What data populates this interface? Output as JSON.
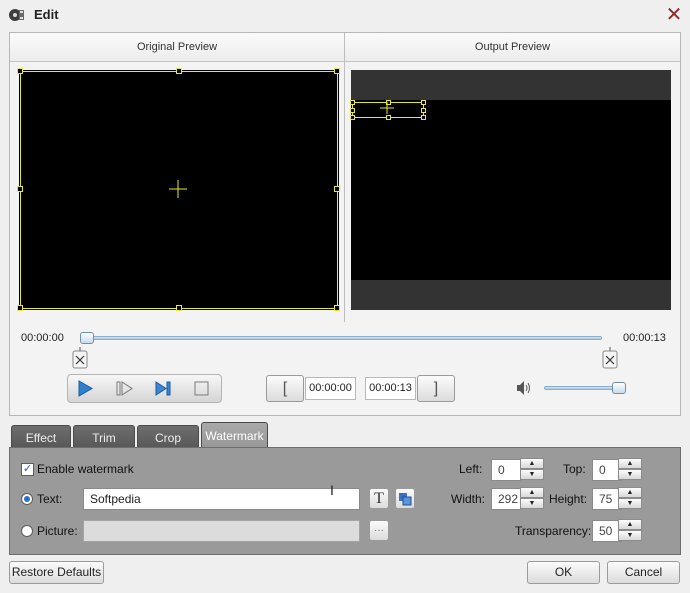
{
  "window": {
    "title": "Edit"
  },
  "preview": {
    "original_label": "Original Preview",
    "output_label": "Output Preview"
  },
  "timeline": {
    "start_time": "00:00:00",
    "end_time": "00:00:13"
  },
  "clip": {
    "start_box": "00:00:00",
    "end_box": "00:00:13",
    "start_bracket": "[",
    "end_bracket": "]"
  },
  "tabs": [
    {
      "label": "Effect"
    },
    {
      "label": "Trim"
    },
    {
      "label": "Crop"
    },
    {
      "label": "Watermark",
      "active": true
    }
  ],
  "watermark": {
    "enable_label": "Enable watermark",
    "enabled": true,
    "text_label": "Text:",
    "text_value": "Softpedia",
    "picture_label": "Picture:",
    "browse_label": "···",
    "text_tool_glyph": "T",
    "left_label": "Left:",
    "left_value": "0",
    "top_label": "Top:",
    "top_value": "0",
    "width_label": "Width:",
    "width_value": "292",
    "height_label": "Height:",
    "height_value": "75",
    "transparency_label": "Transparency:",
    "transparency_value": "50"
  },
  "footer": {
    "restore_label": "Restore Defaults",
    "ok_label": "OK",
    "cancel_label": "Cancel"
  },
  "volume_level": 0.85,
  "colors": {
    "accent": "#2a6fc9",
    "overlay": "#e8e83a",
    "close": "#8e2b2b"
  }
}
